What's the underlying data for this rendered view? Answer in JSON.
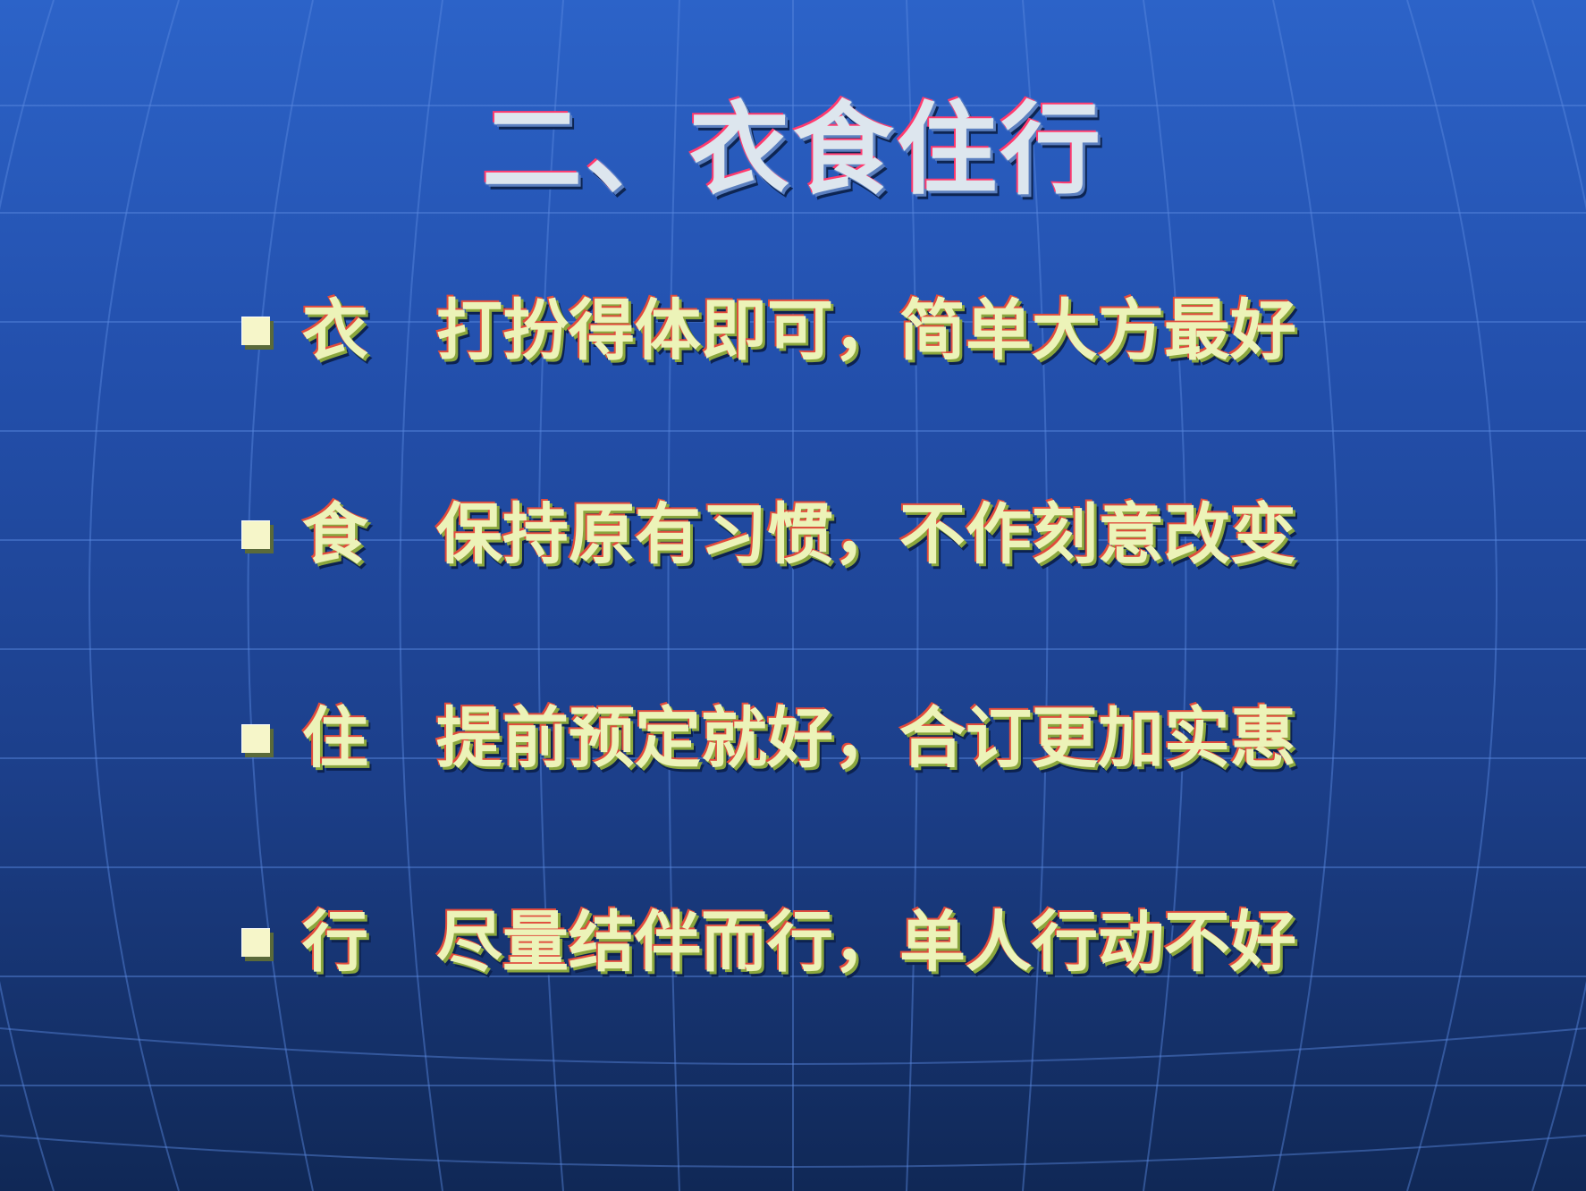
{
  "slide": {
    "title": "二、衣食住行",
    "items": [
      {
        "key": "衣",
        "text": "打扮得体即可，简单大方最好"
      },
      {
        "key": "食",
        "text": "保持原有习惯，不作刻意改变"
      },
      {
        "key": "住",
        "text": "提前预定就好，合订更加实惠"
      },
      {
        "key": "行",
        "text": "尽量结伴而行，单人行动不好"
      }
    ]
  },
  "colors": {
    "background_top": "#2c63c8",
    "background_bottom": "#102856",
    "title_text": "#dde6ee",
    "bullet_text": "#ecf3b8",
    "bullet_marker": "#f6f6c9",
    "grid_line": "#4f7fd6"
  },
  "icons": {
    "bullet": "square-bullet-icon"
  }
}
